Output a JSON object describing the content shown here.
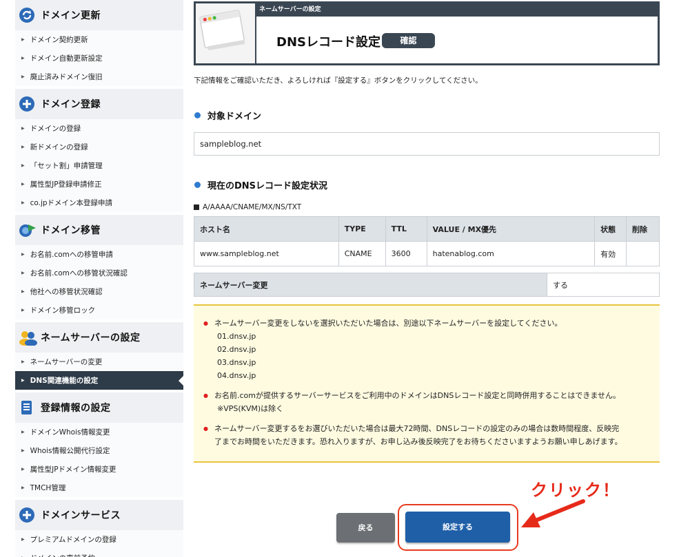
{
  "sidebar": {
    "sections": [
      {
        "title": "ドメイン更新",
        "icon": "refresh-icon",
        "items": [
          "ドメイン契約更新",
          "ドメイン自動更新設定",
          "廃止済みドメイン復旧"
        ]
      },
      {
        "title": "ドメイン登録",
        "icon": "plus-icon",
        "items": [
          "ドメインの登録",
          "新ドメインの登録",
          "「セット割」申請管理",
          "属性型JP登録申請修正",
          "co.jpドメイン本登録申請"
        ]
      },
      {
        "title": "ドメイン移管",
        "icon": "transfer-icon",
        "items": [
          "お名前.comへの移管申請",
          "お名前.comへの移管状況確認",
          "他社への移管状況確認",
          "ドメイン移管ロック"
        ]
      },
      {
        "title": "ネームサーバーの設定",
        "icon": "users-icon",
        "items": [
          "ネームサーバーの変更",
          "DNS関連機能の設定"
        ]
      },
      {
        "title": "登録情報の設定",
        "icon": "document-icon",
        "items": [
          "ドメインWhois情報変更",
          "Whois情報公開代行設定",
          "属性型JPドメイン情報変更",
          "TMCH管理"
        ]
      },
      {
        "title": "ドメインサービス",
        "icon": "plus-icon",
        "items": [
          "プレミアムドメインの登録",
          "ドメインの事前予約"
        ]
      }
    ],
    "active_item": "DNS関連機能の設定"
  },
  "header": {
    "band": "ネームサーバーの設定",
    "title": "DNSレコード設定",
    "badge": "確認"
  },
  "instruction": "下記情報をご確認いただき、よろしければ『設定する』ボタンをクリックしてください。",
  "target_domain": {
    "heading": "対象ドメイン",
    "value": "sampleblog.net"
  },
  "dns_status": {
    "heading": "現在のDNSレコード設定状況",
    "record_types": "A/AAAA/CNAME/MX/NS/TXT",
    "columns": [
      "ホスト名",
      "TYPE",
      "TTL",
      "VALUE / MX優先",
      "状態",
      "削除"
    ],
    "rows": [
      [
        "www.sampleblog.net",
        "CNAME",
        "3600",
        "hatenablog.com",
        "有効",
        ""
      ]
    ]
  },
  "nameserver_change": {
    "label": "ネームサーバー変更",
    "value": "する"
  },
  "notice": {
    "items": [
      [
        "ネームサーバー変更をしないを選択いただいた場合は、別途以下ネームサーバーを設定してください。",
        "01.dnsv.jp",
        "02.dnsv.jp",
        "03.dnsv.jp",
        "04.dnsv.jp"
      ],
      [
        "お名前.comが提供するサーバーサービスをご利用中のドメインはDNSレコード設定と同時併用することはできません。",
        "※VPS(KVM)は除く"
      ],
      [
        "ネームサーバー変更するをお選びいただいた場合は最大72時間、DNSレコードの設定のみの場合は数時間程度、反映完",
        "了までお時間をいただきます。恐れ入りますが、お申し込み後反映完了をお待ちくださいますようお願い申しあげます。"
      ]
    ]
  },
  "buttons": {
    "back": "戻る",
    "submit": "設定する"
  },
  "annotation": {
    "text": "クリック！",
    "color": "#e62a1a"
  },
  "colors": {
    "header_dark": "#3a4753",
    "primary_button": "#1f5fa8",
    "bullet_blue": "#2f7bd0",
    "notice_bg": "#fefbe1"
  }
}
